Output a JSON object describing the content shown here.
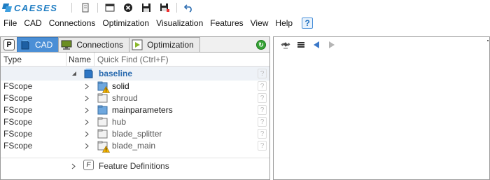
{
  "app": {
    "brand": "CAESES",
    "brand_color": "#1e7cc2"
  },
  "toolbar": {
    "icons": [
      "logo-mark-icon",
      "bookmark-icon",
      "new-window-icon",
      "close-circle-icon",
      "save-icon",
      "save-as-icon",
      "undo-icon"
    ]
  },
  "menubar": {
    "items": [
      "File",
      "CAD",
      "Connections",
      "Optimization",
      "Visualization",
      "Features",
      "View",
      "Help"
    ],
    "help_icon": "?"
  },
  "left_panel": {
    "tab_p_label": "P",
    "tabs": [
      {
        "label": "CAD",
        "icon": "cad-cube-icon",
        "active": true
      },
      {
        "label": "Connections",
        "icon": "monitor-icon",
        "active": false
      },
      {
        "label": "Optimization",
        "icon": "play-icon",
        "active": false
      }
    ],
    "columns": {
      "type": "Type",
      "name": "Name",
      "quick_find": "Quick Find (Ctrl+F)"
    },
    "tree": {
      "root": {
        "label": "baseline",
        "qmark": "?"
      },
      "children": [
        {
          "type": "FScope",
          "label": "solid",
          "warning": true,
          "qmark": "?"
        },
        {
          "type": "FScope",
          "label": "shroud",
          "warning": false,
          "qmark": "?"
        },
        {
          "type": "FScope",
          "label": "mainparameters",
          "warning": false,
          "qmark": "?"
        },
        {
          "type": "FScope",
          "label": "hub",
          "warning": false,
          "qmark": "?"
        },
        {
          "type": "FScope",
          "label": "blade_splitter",
          "warning": false,
          "qmark": "?"
        },
        {
          "type": "FScope",
          "label": "blade_main",
          "warning": true,
          "qmark": "?"
        }
      ]
    },
    "feature_definitions": {
      "icon_label": "F",
      "label": "Feature Definitions"
    }
  },
  "right_panel": {
    "icons": [
      "satellite-icon",
      "list-icon",
      "back-arrow-icon",
      "forward-arrow-icon"
    ]
  },
  "colors": {
    "active_tab": "#4b8fd6",
    "root_label": "#2b6cb0",
    "warning": "#f5b400",
    "refresh": "#36a336"
  }
}
